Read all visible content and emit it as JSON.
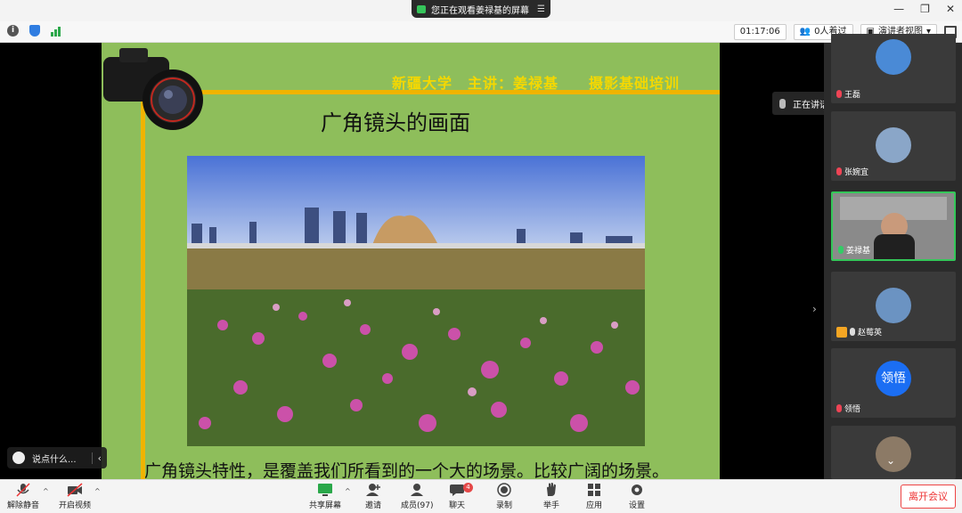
{
  "titlebar": {
    "share_status": "您正在观看姜禄基的屏幕"
  },
  "toolbar": {
    "timer": "01:17:06",
    "members_waiting": "0人着过",
    "view_mode": "演讲者视图"
  },
  "slide": {
    "header": "新疆大学　主讲：姜禄基　　摄影基础培训",
    "title": "广角镜头的画面",
    "caption": "广角镜头特性，是覆盖我们所看到的一个大的场景。比较广阔的场景。"
  },
  "chat": {
    "placeholder": "说点什么..."
  },
  "speaking": {
    "label": "正在讲话: 姜禄基;"
  },
  "participants": [
    {
      "name": "王磊",
      "mic": "muted"
    },
    {
      "name": "张婉宜",
      "mic": "muted"
    },
    {
      "name": "姜禄基",
      "mic": "on",
      "active": true
    },
    {
      "name": "赵莓英",
      "mic": "muted",
      "host": true
    },
    {
      "name": "领悟",
      "mic": "muted",
      "avatar_text": "领悟"
    },
    {
      "name": "",
      "mic": "muted"
    }
  ],
  "bottombar": {
    "unmute": "解除静音",
    "video": "开启视频",
    "share": "共享屏幕",
    "invite": "邀请",
    "members": "成员(97)",
    "chat": "聊天",
    "chat_badge": "4",
    "record": "录制",
    "raise_hand": "举手",
    "apps": "应用",
    "settings": "设置",
    "leave": "离开会议"
  },
  "colors": {
    "slide_bg": "#8ebe5b",
    "gold": "#f0b400",
    "leave": "#e33333",
    "active_border": "#34c759"
  }
}
